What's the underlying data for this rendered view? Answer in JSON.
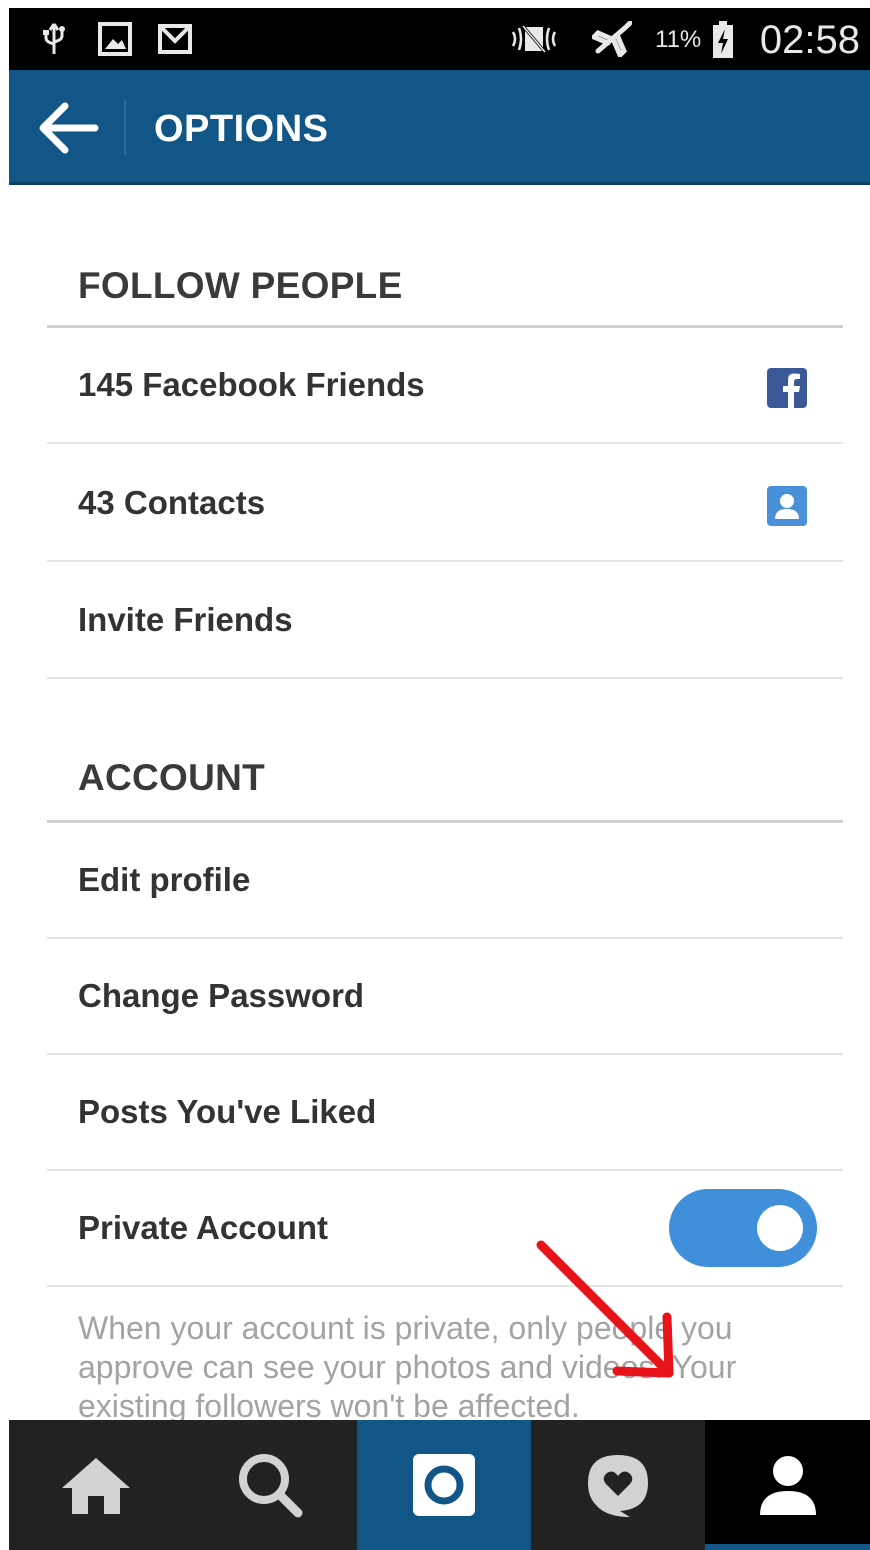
{
  "status_bar": {
    "time": "02:58",
    "battery_percent": "11%",
    "icons": [
      "usb-icon",
      "image-icon",
      "gmail-icon",
      "vibrate-icon",
      "airplane-icon",
      "battery-icon"
    ]
  },
  "app_bar": {
    "title": "OPTIONS",
    "back_icon": "arrow-left-icon"
  },
  "follow_people": {
    "heading": "FOLLOW PEOPLE",
    "items": [
      {
        "label": "145 Facebook Friends",
        "icon": "facebook-icon"
      },
      {
        "label": "43 Contacts",
        "icon": "contacts-icon"
      },
      {
        "label": "Invite Friends"
      }
    ]
  },
  "account": {
    "heading": "ACCOUNT",
    "items": [
      {
        "label": "Edit profile"
      },
      {
        "label": "Change Password"
      },
      {
        "label": "Posts You've Liked"
      },
      {
        "label": "Private Account",
        "toggle_on": true
      }
    ],
    "private_helper": "When your account is private, only people you approve can see your photos and videos. Your existing followers won't be affected."
  },
  "bottom_nav": {
    "tabs": [
      "home-icon",
      "search-icon",
      "camera-icon",
      "activity-icon",
      "profile-icon"
    ],
    "active": "profile-icon"
  },
  "colors": {
    "brand_blue": "#125688",
    "toggle_blue": "#3f8fdb",
    "annotation_red": "#e8141b"
  }
}
